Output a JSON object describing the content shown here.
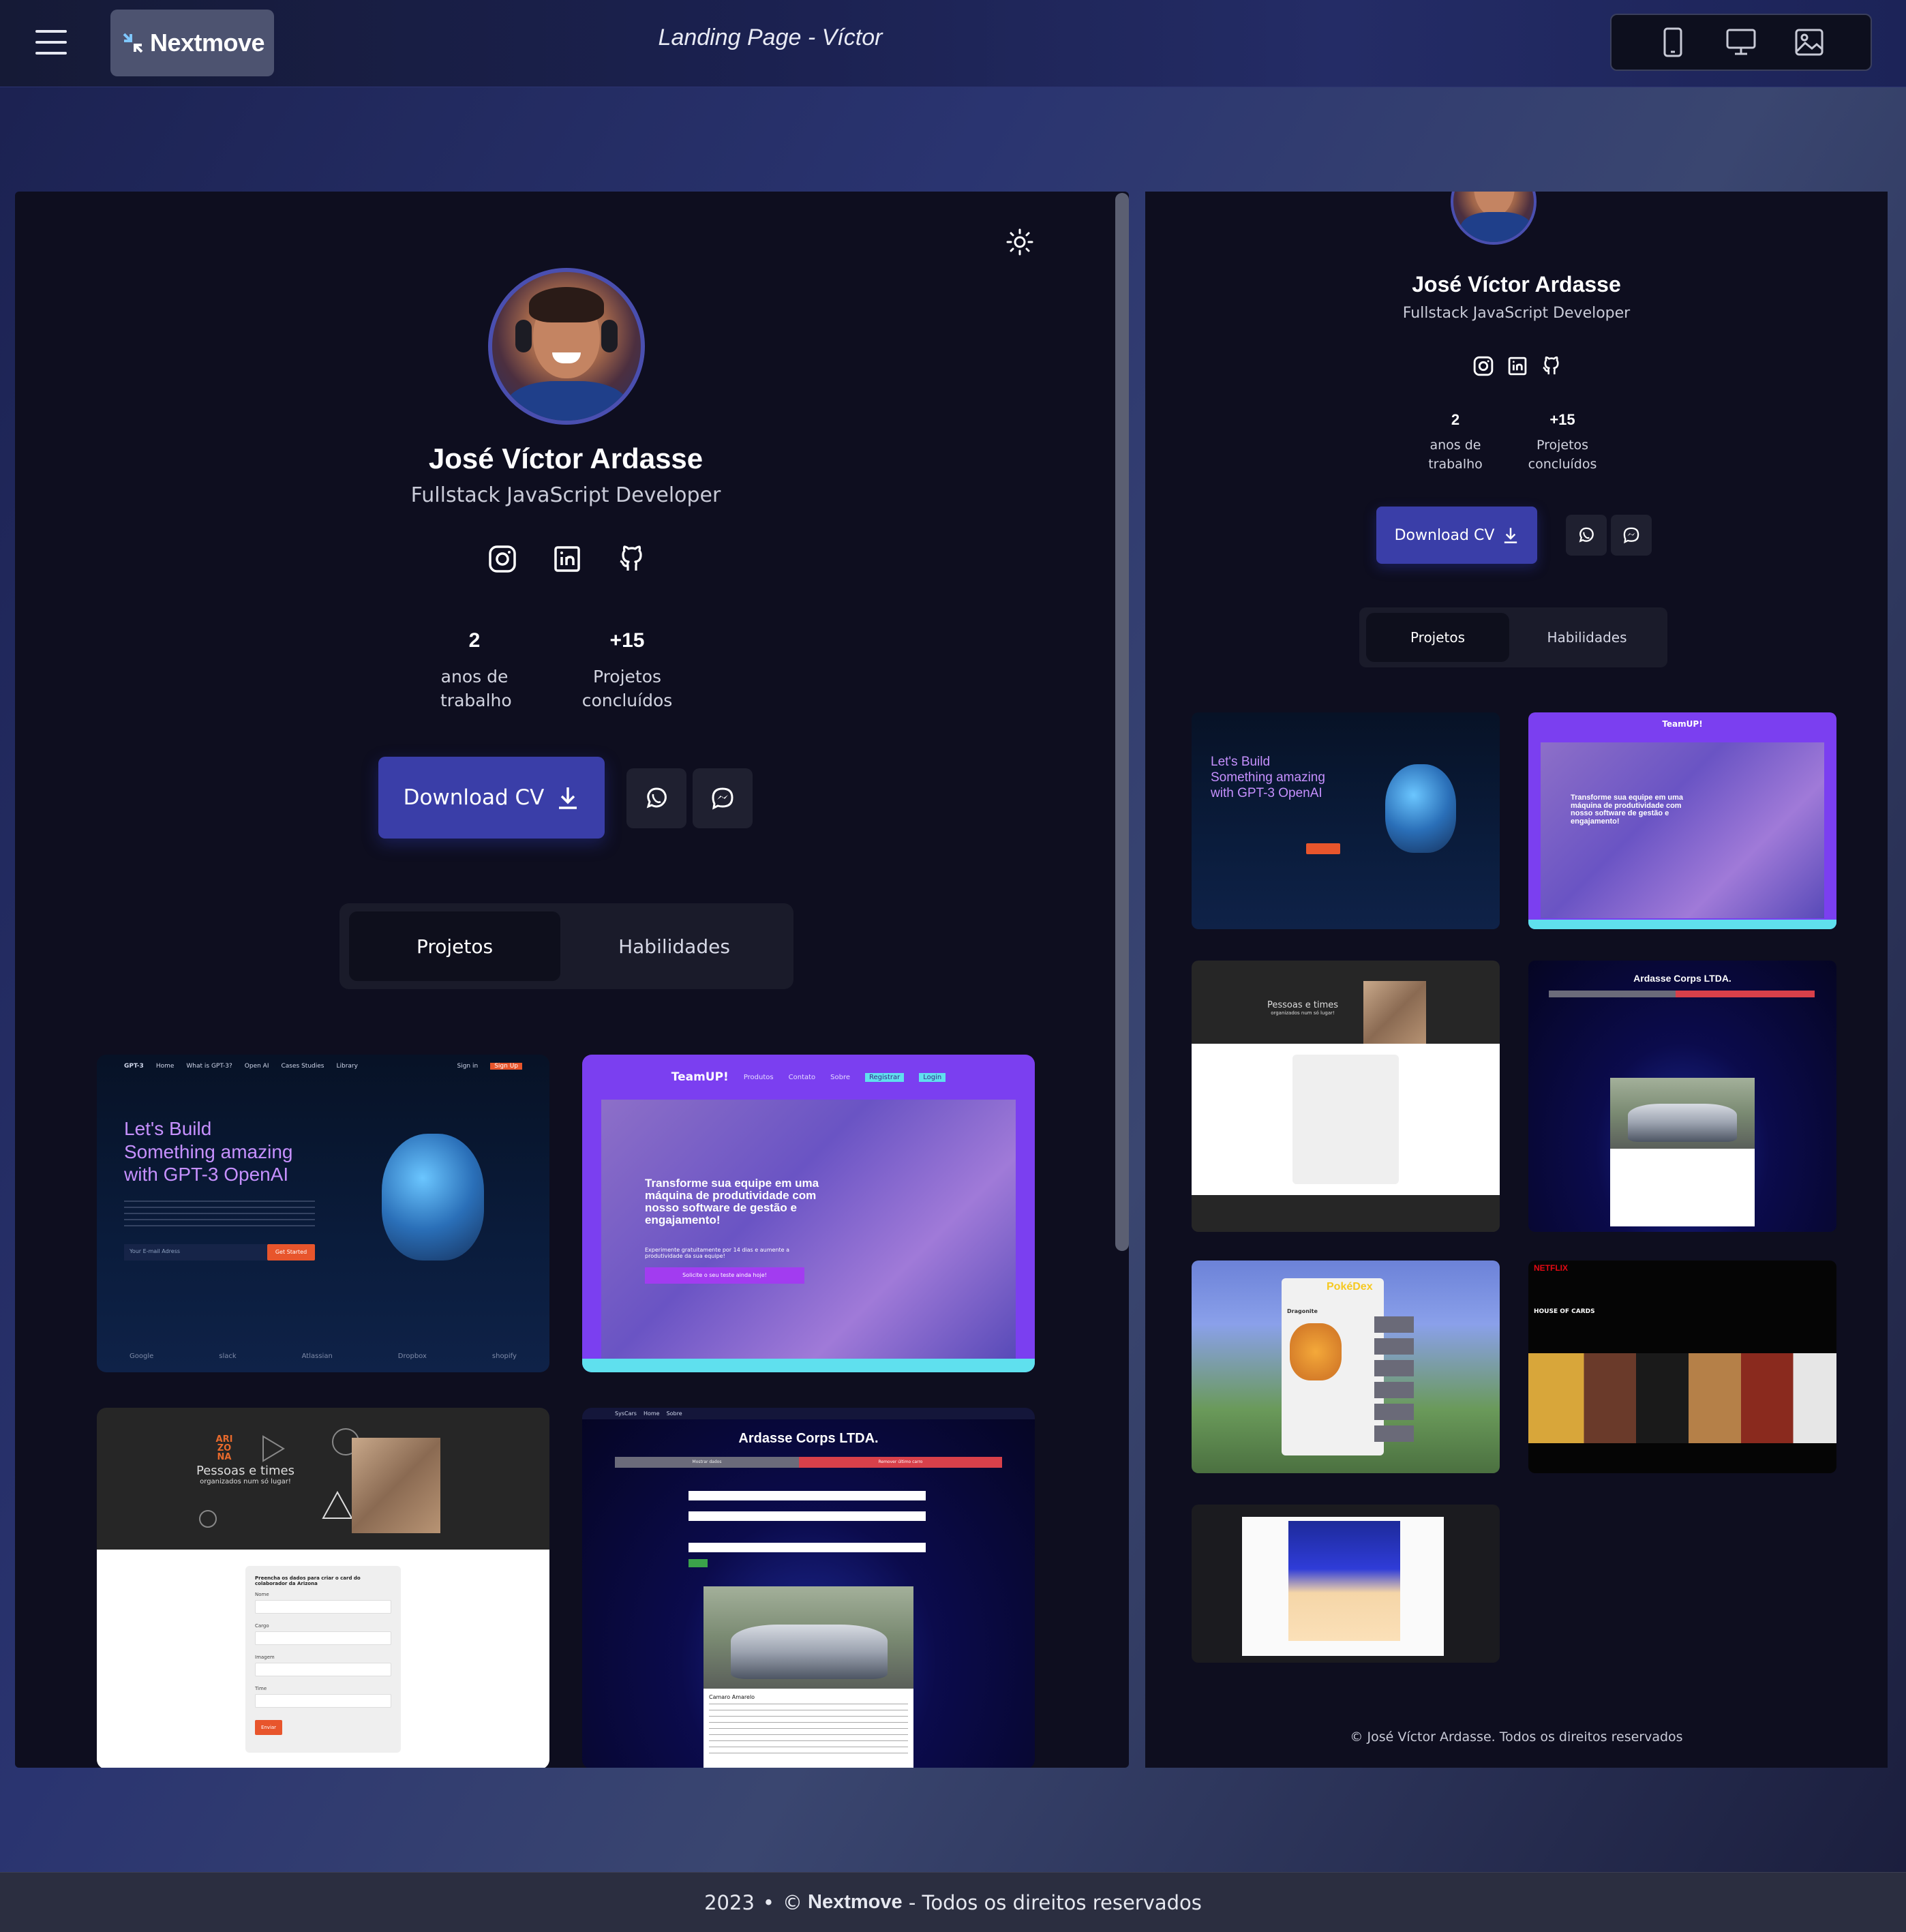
{
  "header": {
    "brand_name": "Nextmove",
    "page_title": "Landing Page - Víctor",
    "device_modes": [
      "mobile",
      "desktop",
      "image"
    ]
  },
  "profile": {
    "name": "José Víctor Ardasse",
    "role": "Fullstack JavaScript Developer",
    "social": [
      "instagram",
      "linkedin",
      "github"
    ],
    "stats": [
      {
        "value": "2",
        "label_line1": "anos de",
        "label_line2": "trabalho"
      },
      {
        "value": "+15",
        "label_line1": "Projetos",
        "label_line2": "concluídos"
      }
    ],
    "download_label": "Download CV",
    "contact_buttons": [
      "whatsapp",
      "messenger"
    ]
  },
  "tabs": [
    {
      "label": "Projetos",
      "active": true
    },
    {
      "label": "Habilidades",
      "active": false
    }
  ],
  "projects": {
    "gpt": {
      "logo": "GPT-3",
      "nav": [
        "Home",
        "What is GPT-3?",
        "Open AI",
        "Cases Studies",
        "Library"
      ],
      "sign_in": "Sign in",
      "sign_up": "Sign Up",
      "title_line1": "Let's Build",
      "title_line2": "Something amazing",
      "title_line3": "with GPT-3 OpenAI",
      "cta": "Get Started",
      "email_placeholder": "Your E-mail Adress",
      "partners": [
        "Google",
        "slack",
        "Atlassian",
        "Dropbox",
        "shopify"
      ]
    },
    "teamup": {
      "logo": "TeamUP!",
      "nav": [
        "Produtos",
        "Contato",
        "Sobre"
      ],
      "register": "Registrar",
      "login": "Login",
      "headline": "Transforme sua equipe em uma máquina de produtividade com nosso software de gestão e engajamento!",
      "subtext": "Experimente gratuitamente por 14 dias e aumente a produtividade da sua equipe!",
      "cta": "Solicite o seu teste ainda hoje!"
    },
    "arizona": {
      "logo": "ARI ZO NA",
      "tagline_line1": "Pessoas e times",
      "tagline_line2": "organizados num só lugar!",
      "form_title": "Preencha os dados para criar o card do colaborador da Arizona",
      "fields": [
        "Nome",
        "Cargo",
        "Imagem",
        "Time"
      ],
      "submit": "Enviar"
    },
    "corp": {
      "nav": [
        "SysCars",
        "Home",
        "Sobre"
      ],
      "title": "Ardasse Corps LTDA.",
      "left_tab": "Mostrar dados",
      "right_tab": "Remover último carro",
      "car_name": "Camaro Amarelo"
    },
    "pokedex": {
      "logo": "PokéDex",
      "pokemon": "Dragonite"
    },
    "netflix": {
      "logo": "NETFLIX",
      "show": "HOUSE OF CARDS"
    }
  },
  "mobile_copyright": "© José Víctor Ardasse. Todos os direitos reservados",
  "footer": {
    "year": "2023",
    "brand": "Nextmove",
    "rights": " - Todos os direitos reservados"
  },
  "colors": {
    "accent": "#3a3ea8",
    "panel_bg": "#0e0e1f",
    "teamup_purple": "#7b3ff0",
    "gpt_orange": "#e8552c"
  }
}
